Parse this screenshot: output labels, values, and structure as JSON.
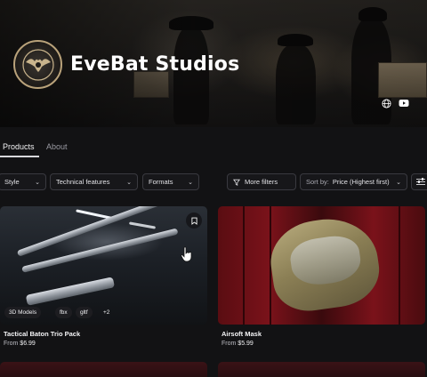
{
  "header": {
    "studio_name": "EveBat Studios",
    "icons": [
      "globe-icon",
      "youtube-icon"
    ]
  },
  "tabs": [
    {
      "label": "Products",
      "active": true
    },
    {
      "label": "About",
      "active": false
    }
  ],
  "filters": {
    "style": "Style",
    "technical": "Technical features",
    "formats": "Formats",
    "more": "More filters",
    "sort_prefix": "Sort by:",
    "sort_value": "Price (Highest first)"
  },
  "products": [
    {
      "title": "Tactical Baton Trio Pack",
      "price_prefix": "From",
      "price": "$6.99",
      "tags": [
        "3D Models",
        "fbx",
        "gltf",
        "+2"
      ]
    },
    {
      "title": "Airsoft Mask",
      "price_prefix": "From",
      "price": "$5.99"
    }
  ],
  "colors": {
    "background": "#121214",
    "accent_logo": "#b9a27a",
    "locker_red": "#7a121a"
  }
}
